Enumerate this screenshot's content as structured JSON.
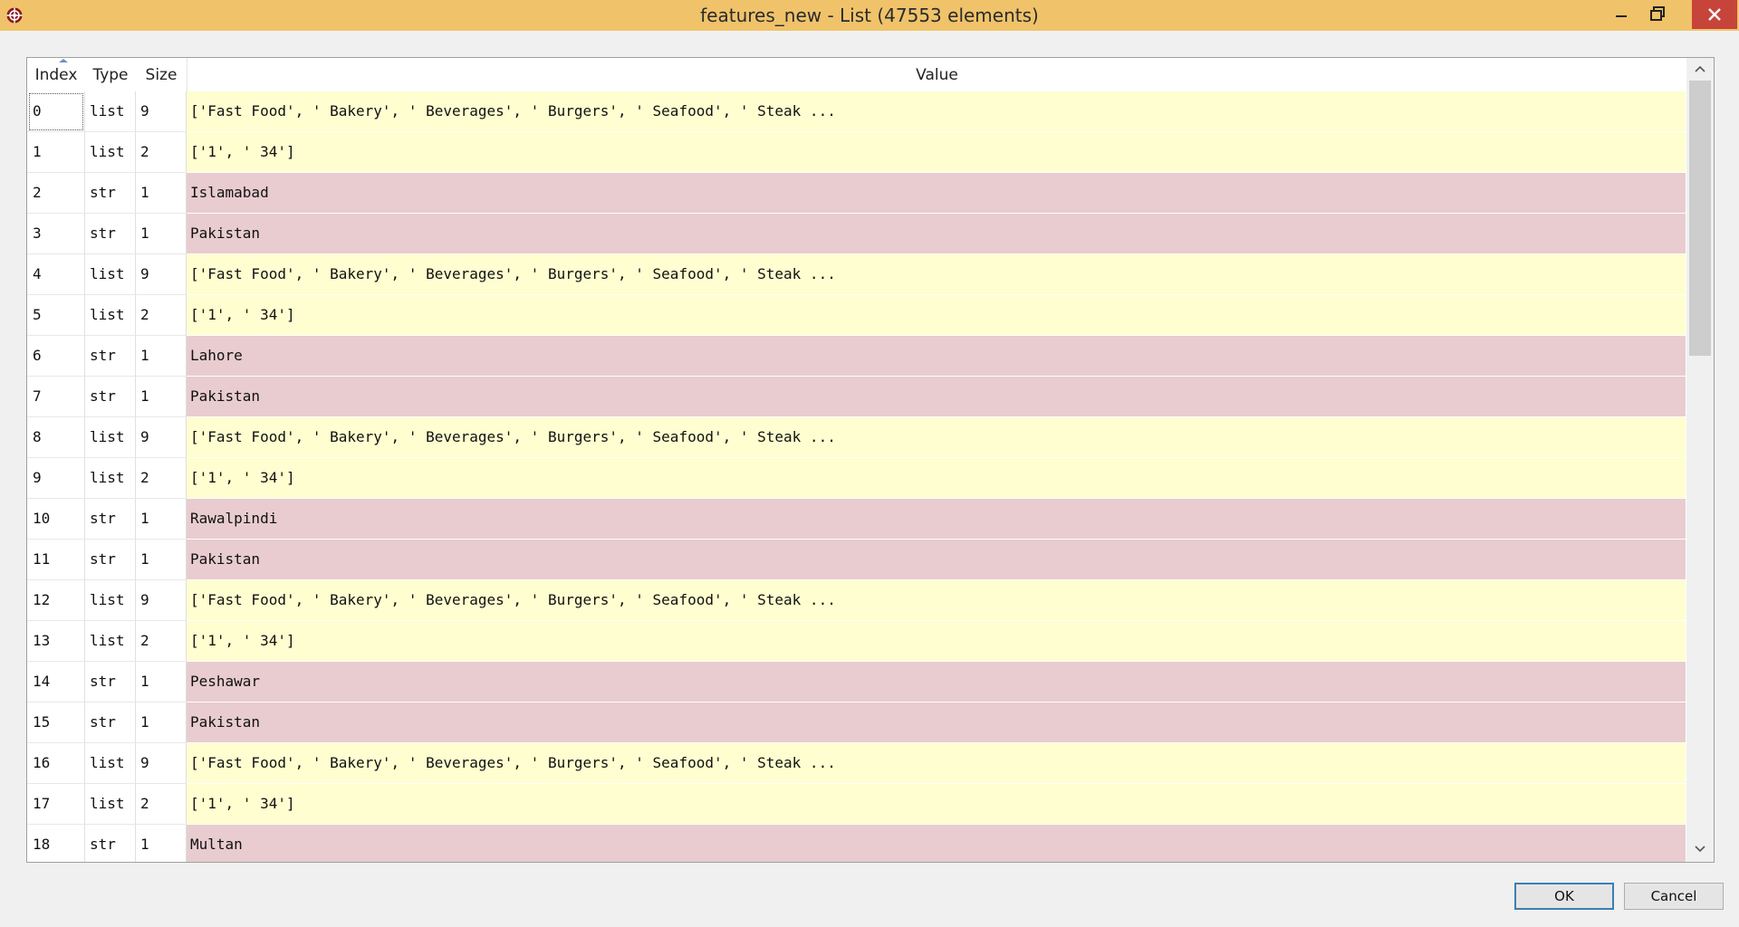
{
  "window": {
    "title": "features_new - List (47553 elements)",
    "accent_color": "#f0c36a",
    "close_color": "#c7443a"
  },
  "table": {
    "columns": {
      "index": "Index",
      "type": "Type",
      "size": "Size",
      "value": "Value"
    },
    "sorted_column": "Index",
    "row_colors": {
      "list": "#fefed0",
      "str": "#e8ccd0"
    },
    "rows": [
      {
        "index": "0",
        "type": "list",
        "size": "9",
        "value": "['Fast Food', ' Bakery', ' Beverages', ' Burgers', ' Seafood', ' Steak ..."
      },
      {
        "index": "1",
        "type": "list",
        "size": "2",
        "value": "['1', ' 34']"
      },
      {
        "index": "2",
        "type": "str",
        "size": "1",
        "value": "Islamabad"
      },
      {
        "index": "3",
        "type": "str",
        "size": "1",
        "value": "Pakistan"
      },
      {
        "index": "4",
        "type": "list",
        "size": "9",
        "value": "['Fast Food', ' Bakery', ' Beverages', ' Burgers', ' Seafood', ' Steak ..."
      },
      {
        "index": "5",
        "type": "list",
        "size": "2",
        "value": "['1', ' 34']"
      },
      {
        "index": "6",
        "type": "str",
        "size": "1",
        "value": "Lahore"
      },
      {
        "index": "7",
        "type": "str",
        "size": "1",
        "value": "Pakistan"
      },
      {
        "index": "8",
        "type": "list",
        "size": "9",
        "value": "['Fast Food', ' Bakery', ' Beverages', ' Burgers', ' Seafood', ' Steak ..."
      },
      {
        "index": "9",
        "type": "list",
        "size": "2",
        "value": "['1', ' 34']"
      },
      {
        "index": "10",
        "type": "str",
        "size": "1",
        "value": "Rawalpindi"
      },
      {
        "index": "11",
        "type": "str",
        "size": "1",
        "value": "Pakistan"
      },
      {
        "index": "12",
        "type": "list",
        "size": "9",
        "value": "['Fast Food', ' Bakery', ' Beverages', ' Burgers', ' Seafood', ' Steak ..."
      },
      {
        "index": "13",
        "type": "list",
        "size": "2",
        "value": "['1', ' 34']"
      },
      {
        "index": "14",
        "type": "str",
        "size": "1",
        "value": "Peshawar"
      },
      {
        "index": "15",
        "type": "str",
        "size": "1",
        "value": "Pakistan"
      },
      {
        "index": "16",
        "type": "list",
        "size": "9",
        "value": "['Fast Food', ' Bakery', ' Beverages', ' Burgers', ' Seafood', ' Steak ..."
      },
      {
        "index": "17",
        "type": "list",
        "size": "2",
        "value": "['1', ' 34']"
      },
      {
        "index": "18",
        "type": "str",
        "size": "1",
        "value": "Multan"
      }
    ]
  },
  "footer": {
    "ok_label": "OK",
    "cancel_label": "Cancel"
  }
}
